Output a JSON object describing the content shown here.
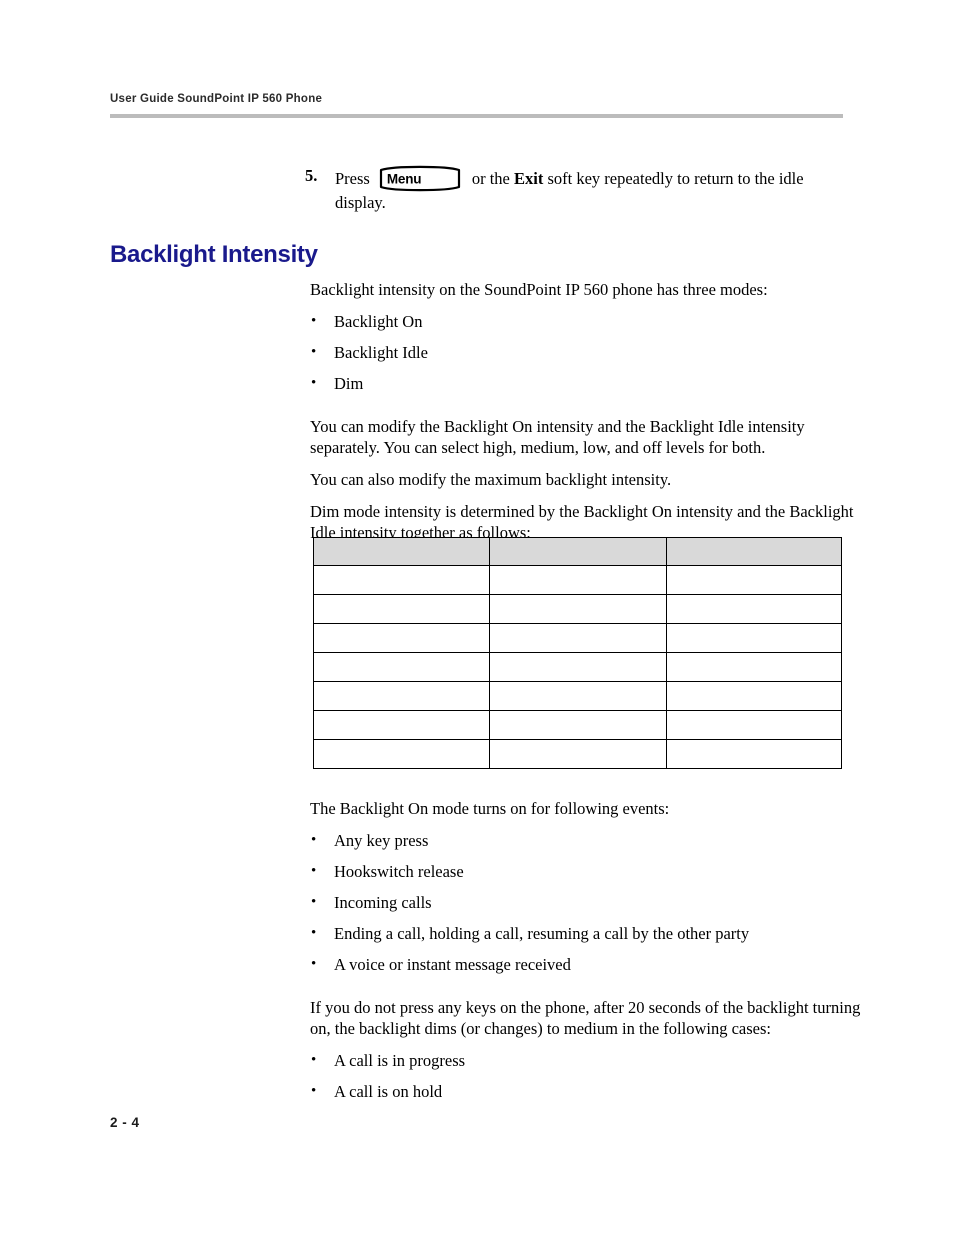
{
  "header": {
    "running_head": "User Guide SoundPoint IP 560 Phone"
  },
  "step": {
    "number": "5.",
    "press_label": "Press",
    "key_label": "Menu",
    "after_key": "or the",
    "softkey_label": "Exit",
    "after_softkey": "soft key repeatedly to return to the idle",
    "line2": "display."
  },
  "section": {
    "heading": "Backlight Intensity",
    "intro": "Backlight intensity on the SoundPoint IP 560 phone has three modes:",
    "modes": [
      "Backlight On",
      "Backlight Idle",
      "Dim"
    ],
    "para_modify": "You can modify the Backlight On intensity and the Backlight Idle intensity separately. You can select high, medium, low, and off levels for both.",
    "para_maximum": "You can also modify the maximum backlight intensity.",
    "para_dim": "Dim mode intensity is determined by the Backlight On intensity and the Backlight Idle intensity together as follows:"
  },
  "dim_table": {
    "columns": [
      "",
      "",
      ""
    ],
    "header_row": [
      "",
      "",
      ""
    ],
    "rows": [
      [
        "",
        "",
        ""
      ],
      [
        "",
        "",
        ""
      ],
      [
        "",
        "",
        ""
      ],
      [
        "",
        "",
        ""
      ],
      [
        "",
        "",
        ""
      ],
      [
        "",
        "",
        ""
      ],
      [
        "",
        "",
        ""
      ]
    ]
  },
  "events": {
    "intro": "The Backlight On mode turns on for following events:",
    "items": [
      "Any key press",
      "Hookswitch release",
      "Incoming calls",
      "Ending a call, holding a call, resuming a call by the other party",
      "A voice or instant message received"
    ]
  },
  "dimming": {
    "intro": "If you do not press any keys on the phone, after 20 seconds of the backlight turning on, the backlight dims (or changes) to medium in the following cases:",
    "items": [
      "A call is in progress",
      "A call is on hold"
    ]
  },
  "footer": {
    "page_number": "2 - 4"
  },
  "colors": {
    "heading": "#1a1a8c",
    "rule": "#bcbcbc",
    "table_header_fill": "#d9d9d9",
    "table_border": "#000000"
  }
}
